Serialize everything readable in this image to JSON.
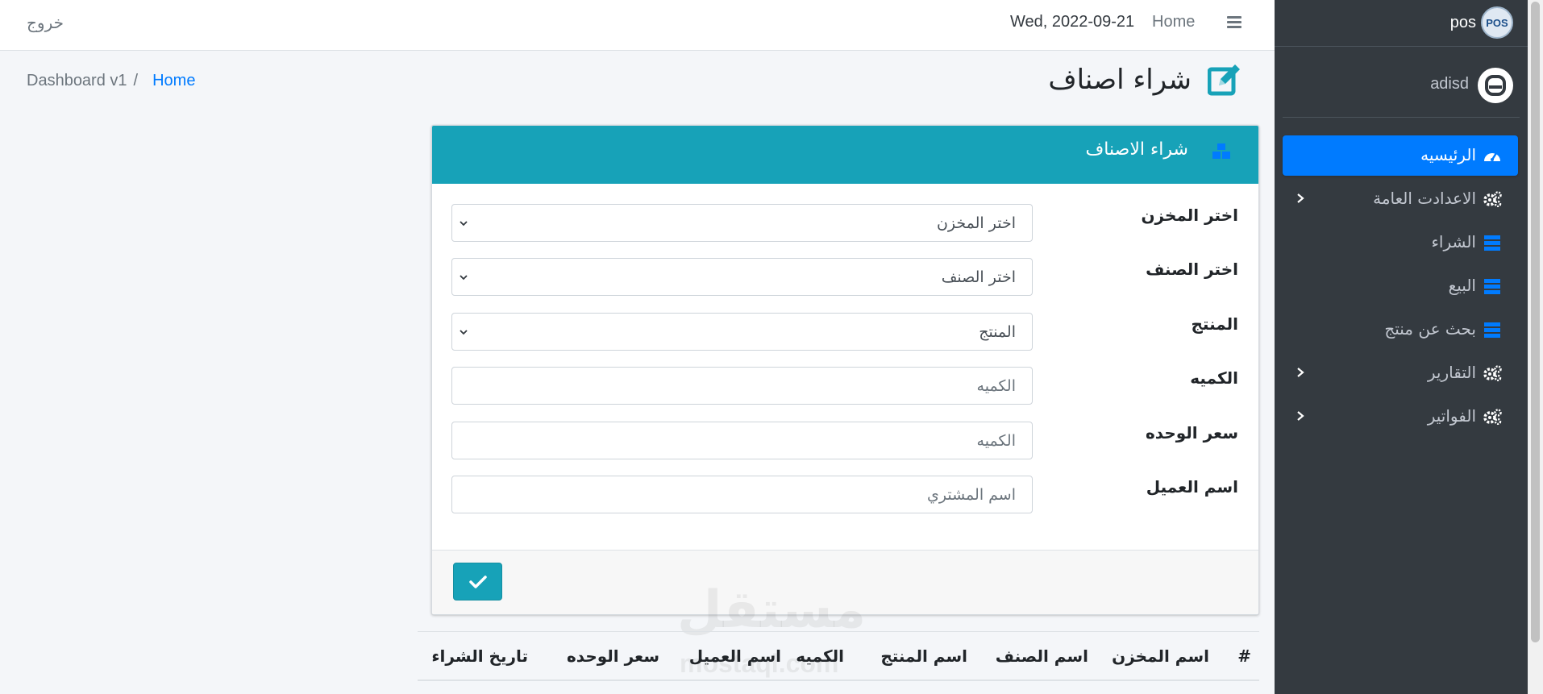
{
  "navbar": {
    "logout_label": "خروج",
    "date": "Wed, 2022-09-21",
    "home_label": "Home"
  },
  "breadcrumb": {
    "item1": "Dashboard v1",
    "separator": "/",
    "item2": "Home"
  },
  "page": {
    "title": "شراء اصناف"
  },
  "card": {
    "header_title": "شراء الاصناف",
    "fields": [
      {
        "label": "اختر المخزن",
        "value": "اختر المخزن",
        "type": "select"
      },
      {
        "label": "اختر الصنف",
        "value": "اختر الصنف",
        "type": "select"
      },
      {
        "label": "المنتج",
        "value": "المنتج",
        "type": "select"
      },
      {
        "label": "الكميه",
        "placeholder": "الكميه",
        "type": "input"
      },
      {
        "label": "سعر الوحده",
        "placeholder": "الكميه",
        "type": "input"
      },
      {
        "label": "اسم العميل",
        "placeholder": "اسم المشتري",
        "type": "input"
      }
    ]
  },
  "table": {
    "headers": [
      "#",
      "اسم المخزن",
      "اسم الصنف",
      "اسم المنتج",
      "الكميه",
      "اسم العميل",
      "سعر الوحده",
      "تاريخ الشراء"
    ]
  },
  "sidebar": {
    "brand_text": "pos",
    "brand_logo_text": "POS",
    "user_name": "adisd",
    "items": [
      {
        "label": "الرئيسيه",
        "icon": "tachometer-icon",
        "active": true,
        "has_submenu": false
      },
      {
        "label": "الاعدادت العامة",
        "icon": "cogs-icon",
        "active": false,
        "has_submenu": true
      },
      {
        "label": "الشراء",
        "icon": "server-icon",
        "active": false,
        "has_submenu": false
      },
      {
        "label": "البيع",
        "icon": "server-icon",
        "active": false,
        "has_submenu": false
      },
      {
        "label": "بحث عن منتج",
        "icon": "server-icon",
        "active": false,
        "has_submenu": false
      },
      {
        "label": "التقارير",
        "icon": "cogs-icon",
        "active": false,
        "has_submenu": true
      },
      {
        "label": "الفواتير",
        "icon": "cogs-icon",
        "active": false,
        "has_submenu": true
      }
    ]
  },
  "watermark": {
    "text": "مستقل",
    "domain": "mostaql.com"
  },
  "colors": {
    "primary": "#007bff",
    "info": "#17a2b8",
    "sidebar_bg": "#343a40"
  }
}
